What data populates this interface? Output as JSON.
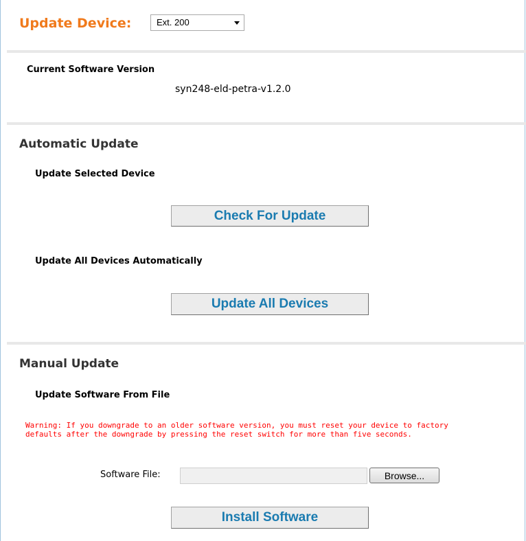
{
  "header": {
    "title": "Update Device:",
    "device_select": "Ext. 200"
  },
  "current_version": {
    "label": "Current Software Version",
    "value": "syn248-eld-petra-v1.2.0"
  },
  "automatic": {
    "title": "Automatic Update",
    "selected_label": "Update Selected Device",
    "check_button": "Check For Update",
    "all_label": "Update All Devices Automatically",
    "all_button": "Update All Devices"
  },
  "manual": {
    "title": "Manual Update",
    "file_label_heading": "Update Software From File",
    "warning": "Warning: If you downgrade to an older software version, you must reset your device to factory\ndefaults after the downgrade by pressing the reset switch for more than five seconds.",
    "software_file_label": "Software File:",
    "software_file_value": "",
    "browse_button": "Browse...",
    "install_button": "Install Software"
  },
  "colors": {
    "title_orange": "#f07a1c",
    "button_text_blue": "#1a7bb0",
    "warning_red": "#ff0000",
    "frame_blue": "#9fc3dd"
  }
}
